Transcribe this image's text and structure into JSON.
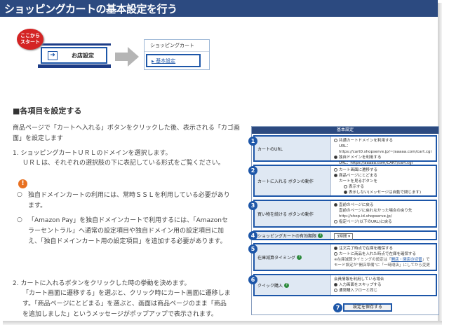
{
  "page": {
    "title": "ショッピングカートの基本設定を行う"
  },
  "flow": {
    "start_badge": "ここから\nスタート",
    "store_button": "お店設定",
    "cart_panel_title": "ショッピングカート",
    "cart_panel_item": "基本設定"
  },
  "section": {
    "heading": "■各項目を設定する",
    "intro": "商品ページで「カートへ入れる」ボタンをクリックした後、表示される「カゴ画面」を設定します",
    "step1_a": "1. ショッピングカートＵＲＬのドメインを選択します。",
    "step1_b": "ＵＲＬは、それぞれの選択肢の下に表記している形式をご覧ください。",
    "bullet1_a": "独自ドメインカートの利用には、常時ＳＳＬを利用している必要があり",
    "bullet1_b": "ます。",
    "bullet2_a": "「Amazon Pay」を独自ドメインカートで利用するには、「Amazonセ",
    "bullet2_b": "ラーセントラル」へ通常の設定項目や独自ドメイン用の設定項目に加",
    "bullet2_c": "え、「独自ドメインカート用の設定項目」を追加する必要があります。",
    "step2_a": "2. カートに入れるボタンをクリックした時の挙動を決めます。",
    "step2_b": "「カート画面に遷移する」を選ぶと、クリック時にカート画面に遷移しま",
    "step2_c": "す。「商品ページにとどまる」を選ぶと、画面は商品ページのまま「商品",
    "step2_d": "を追加しました」というメッセージがポップアップで表示されます。"
  },
  "settings": {
    "header": "基本設定",
    "rows": [
      {
        "num": "1",
        "label": "カートのURL",
        "opt1": "共通カートドメインを利用する",
        "opt1_url": "URL：https://cart0.shopserve.jp/~/aaaaa.com/cart.cgi",
        "opt2": "独自ドメインを利用する",
        "opt2_url": "URL：https://aaaaa.com/CART/cart.cgi"
      },
      {
        "num": "2",
        "label": "カートに入れる ボタンの動作",
        "opt1": "カート画面に遷移する",
        "opt2": "商品ページにとどまる",
        "sub": "カートを見るボタンを",
        "sub1": "表示する",
        "sub2": "表示しない(メッセージは自動で閉じます)"
      },
      {
        "num": "3",
        "label": "買い物を続ける ボタンの動作",
        "opt1": "直前のページに戻る",
        "opt1_note": "直前のページに戻れなかった場合の戻り先",
        "opt1_url": "http://shop.id.shopserve.jp/",
        "opt2": "指定ページ(以下のURL)に戻る"
      },
      {
        "num": "4",
        "label": "ショッピングカートの有効期限",
        "select": "3時間"
      },
      {
        "num": "5",
        "label": "在庫減算タイミング",
        "opt1": "注文完了時点で在庫を確保する",
        "opt2": "カートに商品を入れた時点で在庫を確保する",
        "note1": "※在庫減算タイミングの設定は「",
        "note_link": "開店・閉店の切替",
        "note2": "」で",
        "note3": "モード設定が\"開店準備\"に「一時閉店」にしてから変更"
      },
      {
        "num": "6",
        "label": "クイック購入",
        "opt0": "会員情報を利用している場合",
        "opt1": "入力画面をスキップする",
        "opt2": "通常購入フローと同じ"
      }
    ],
    "save_num": "7",
    "save_label": "設定を保存する"
  },
  "colors": {
    "header_bg": "#2c4a80",
    "highlight": "#1d56a8",
    "badge_red": "#d42424",
    "warning": "#e87020"
  }
}
